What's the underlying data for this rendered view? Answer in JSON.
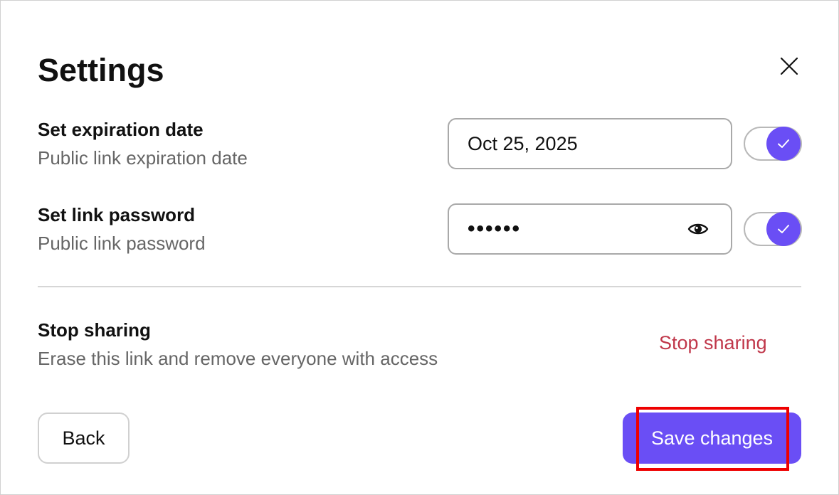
{
  "dialog": {
    "title": "Settings",
    "close_icon": "close-icon"
  },
  "expiration": {
    "title": "Set expiration date",
    "subtitle": "Public link expiration date",
    "value": "Oct 25, 2025",
    "enabled": true
  },
  "password": {
    "title": "Set link password",
    "subtitle": "Public link password",
    "masked_value": "••••••",
    "reveal_icon": "eye-icon",
    "enabled": true
  },
  "stop_sharing": {
    "title": "Stop sharing",
    "subtitle": "Erase this link and remove everyone with access",
    "action_label": "Stop sharing"
  },
  "footer": {
    "back_label": "Back",
    "save_label": "Save changes"
  },
  "colors": {
    "accent": "#6a4ef5",
    "danger": "#c0374a",
    "highlight": "#ee0000"
  }
}
